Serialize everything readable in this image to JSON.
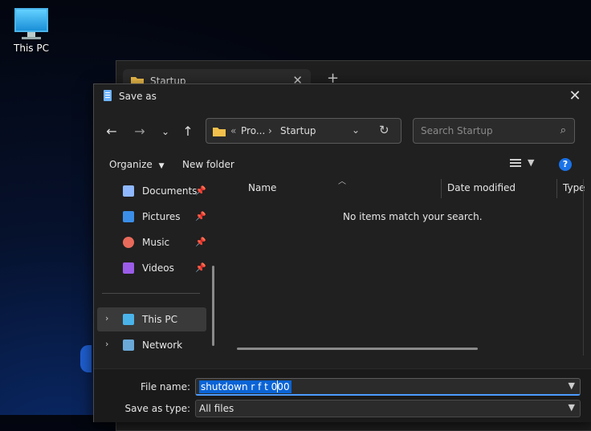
{
  "desktop": {
    "this_pc_label": "This PC"
  },
  "explorer": {
    "tab_title": "Startup"
  },
  "dialog": {
    "title": "Save as",
    "address": {
      "segment_1": "Pro...",
      "segment_2": "Startup"
    },
    "search_placeholder": "Search Startup",
    "commands": {
      "organize": "Organize",
      "new_folder": "New folder"
    },
    "sidebar": {
      "quick_access": [
        {
          "label": "Documents",
          "icon": "documents-icon",
          "color": "#8fb8ff"
        },
        {
          "label": "Pictures",
          "icon": "pictures-icon",
          "color": "#3b8ee8"
        },
        {
          "label": "Music",
          "icon": "music-icon",
          "color": "#e86a5a"
        },
        {
          "label": "Videos",
          "icon": "videos-icon",
          "color": "#9b5ce8"
        }
      ],
      "this_pc": "This PC",
      "network": "Network"
    },
    "columns": {
      "name": "Name",
      "date_modified": "Date modified",
      "type": "Type"
    },
    "empty_message": "No items match your search.",
    "file_name_label": "File name:",
    "file_name_value": "shutdown r f t 000",
    "save_as_type_label": "Save as type:",
    "save_as_type_value": "All files"
  }
}
